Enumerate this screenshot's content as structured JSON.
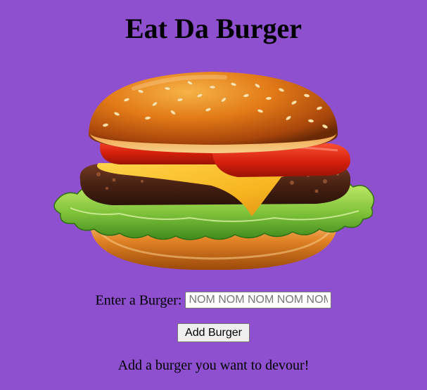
{
  "page": {
    "title": "Eat Da Burger",
    "background_color": "#8f50d0"
  },
  "hero_image": {
    "icon": "burger-illustration"
  },
  "form": {
    "label": "Enter a Burger:",
    "input_placeholder": "NOM NOM NOM NOM NOM",
    "input_value": "",
    "submit_label": "Add Burger"
  },
  "message": "Add a burger you want to devour!"
}
